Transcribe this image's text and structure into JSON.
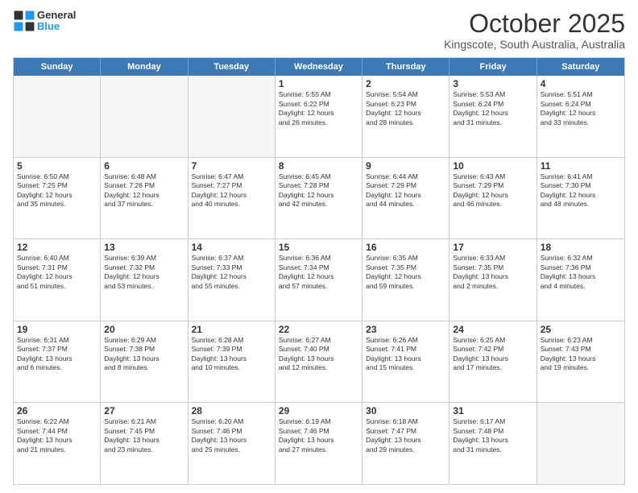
{
  "header": {
    "logo_general": "General",
    "logo_blue": "Blue",
    "title": "October 2025",
    "subtitle": "Kingscote, South Australia, Australia"
  },
  "calendar": {
    "days_of_week": [
      "Sunday",
      "Monday",
      "Tuesday",
      "Wednesday",
      "Thursday",
      "Friday",
      "Saturday"
    ],
    "rows": [
      [
        {
          "day": "",
          "empty": true
        },
        {
          "day": "",
          "empty": true
        },
        {
          "day": "",
          "empty": true
        },
        {
          "day": "1",
          "info": "Sunrise: 5:55 AM\nSunset: 6:22 PM\nDaylight: 12 hours\nand 26 minutes."
        },
        {
          "day": "2",
          "info": "Sunrise: 5:54 AM\nSunset: 6:23 PM\nDaylight: 12 hours\nand 28 minutes."
        },
        {
          "day": "3",
          "info": "Sunrise: 5:53 AM\nSunset: 6:24 PM\nDaylight: 12 hours\nand 31 minutes."
        },
        {
          "day": "4",
          "info": "Sunrise: 5:51 AM\nSunset: 6:24 PM\nDaylight: 12 hours\nand 33 minutes."
        }
      ],
      [
        {
          "day": "5",
          "info": "Sunrise: 6:50 AM\nSunset: 7:25 PM\nDaylight: 12 hours\nand 35 minutes."
        },
        {
          "day": "6",
          "info": "Sunrise: 6:48 AM\nSunset: 7:26 PM\nDaylight: 12 hours\nand 37 minutes."
        },
        {
          "day": "7",
          "info": "Sunrise: 6:47 AM\nSunset: 7:27 PM\nDaylight: 12 hours\nand 40 minutes."
        },
        {
          "day": "8",
          "info": "Sunrise: 6:45 AM\nSunset: 7:28 PM\nDaylight: 12 hours\nand 42 minutes."
        },
        {
          "day": "9",
          "info": "Sunrise: 6:44 AM\nSunset: 7:29 PM\nDaylight: 12 hours\nand 44 minutes."
        },
        {
          "day": "10",
          "info": "Sunrise: 6:43 AM\nSunset: 7:29 PM\nDaylight: 12 hours\nand 46 minutes."
        },
        {
          "day": "11",
          "info": "Sunrise: 6:41 AM\nSunset: 7:30 PM\nDaylight: 12 hours\nand 48 minutes."
        }
      ],
      [
        {
          "day": "12",
          "info": "Sunrise: 6:40 AM\nSunset: 7:31 PM\nDaylight: 12 hours\nand 51 minutes."
        },
        {
          "day": "13",
          "info": "Sunrise: 6:39 AM\nSunset: 7:32 PM\nDaylight: 12 hours\nand 53 minutes."
        },
        {
          "day": "14",
          "info": "Sunrise: 6:37 AM\nSunset: 7:33 PM\nDaylight: 12 hours\nand 55 minutes."
        },
        {
          "day": "15",
          "info": "Sunrise: 6:36 AM\nSunset: 7:34 PM\nDaylight: 12 hours\nand 57 minutes."
        },
        {
          "day": "16",
          "info": "Sunrise: 6:35 AM\nSunset: 7:35 PM\nDaylight: 12 hours\nand 59 minutes."
        },
        {
          "day": "17",
          "info": "Sunrise: 6:33 AM\nSunset: 7:35 PM\nDaylight: 13 hours\nand 2 minutes."
        },
        {
          "day": "18",
          "info": "Sunrise: 6:32 AM\nSunset: 7:36 PM\nDaylight: 13 hours\nand 4 minutes."
        }
      ],
      [
        {
          "day": "19",
          "info": "Sunrise: 6:31 AM\nSunset: 7:37 PM\nDaylight: 13 hours\nand 6 minutes."
        },
        {
          "day": "20",
          "info": "Sunrise: 6:29 AM\nSunset: 7:38 PM\nDaylight: 13 hours\nand 8 minutes."
        },
        {
          "day": "21",
          "info": "Sunrise: 6:28 AM\nSunset: 7:39 PM\nDaylight: 13 hours\nand 10 minutes."
        },
        {
          "day": "22",
          "info": "Sunrise: 6:27 AM\nSunset: 7:40 PM\nDaylight: 13 hours\nand 12 minutes."
        },
        {
          "day": "23",
          "info": "Sunrise: 6:26 AM\nSunset: 7:41 PM\nDaylight: 13 hours\nand 15 minutes."
        },
        {
          "day": "24",
          "info": "Sunrise: 6:25 AM\nSunset: 7:42 PM\nDaylight: 13 hours\nand 17 minutes."
        },
        {
          "day": "25",
          "info": "Sunrise: 6:23 AM\nSunset: 7:43 PM\nDaylight: 13 hours\nand 19 minutes."
        }
      ],
      [
        {
          "day": "26",
          "info": "Sunrise: 6:22 AM\nSunset: 7:44 PM\nDaylight: 13 hours\nand 21 minutes."
        },
        {
          "day": "27",
          "info": "Sunrise: 6:21 AM\nSunset: 7:45 PM\nDaylight: 13 hours\nand 23 minutes."
        },
        {
          "day": "28",
          "info": "Sunrise: 6:20 AM\nSunset: 7:46 PM\nDaylight: 13 hours\nand 25 minutes."
        },
        {
          "day": "29",
          "info": "Sunrise: 6:19 AM\nSunset: 7:46 PM\nDaylight: 13 hours\nand 27 minutes."
        },
        {
          "day": "30",
          "info": "Sunrise: 6:18 AM\nSunset: 7:47 PM\nDaylight: 13 hours\nand 29 minutes."
        },
        {
          "day": "31",
          "info": "Sunrise: 6:17 AM\nSunset: 7:48 PM\nDaylight: 13 hours\nand 31 minutes."
        },
        {
          "day": "",
          "empty": true
        }
      ]
    ]
  }
}
